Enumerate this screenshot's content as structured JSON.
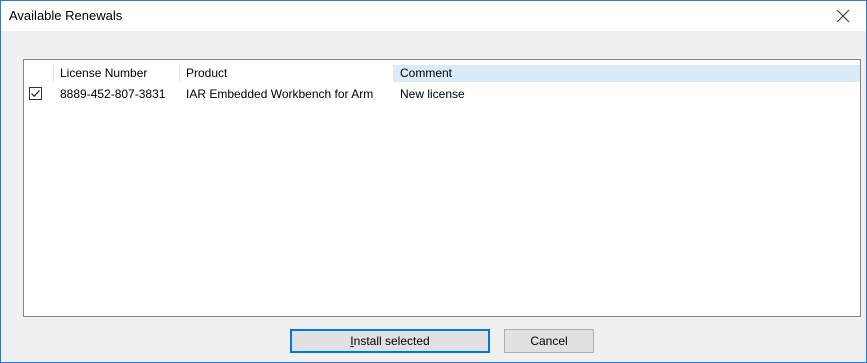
{
  "window": {
    "title": "Available Renewals"
  },
  "icons": {
    "close": "close-icon",
    "check": "checkmark-icon"
  },
  "colors": {
    "accent": "#0078d7",
    "selected_header": "#d9ebf9",
    "border": "#2b79d4"
  },
  "list": {
    "columns": [
      "",
      "License Number",
      "Product",
      "Comment"
    ],
    "rows": [
      {
        "checked": true,
        "license_number": "8889-452-807-3831",
        "product": "IAR Embedded Workbench for Arm",
        "comment": "New license"
      }
    ]
  },
  "buttons": {
    "install_mnemonic": "I",
    "install_rest": "nstall selected",
    "cancel": "Cancel"
  }
}
